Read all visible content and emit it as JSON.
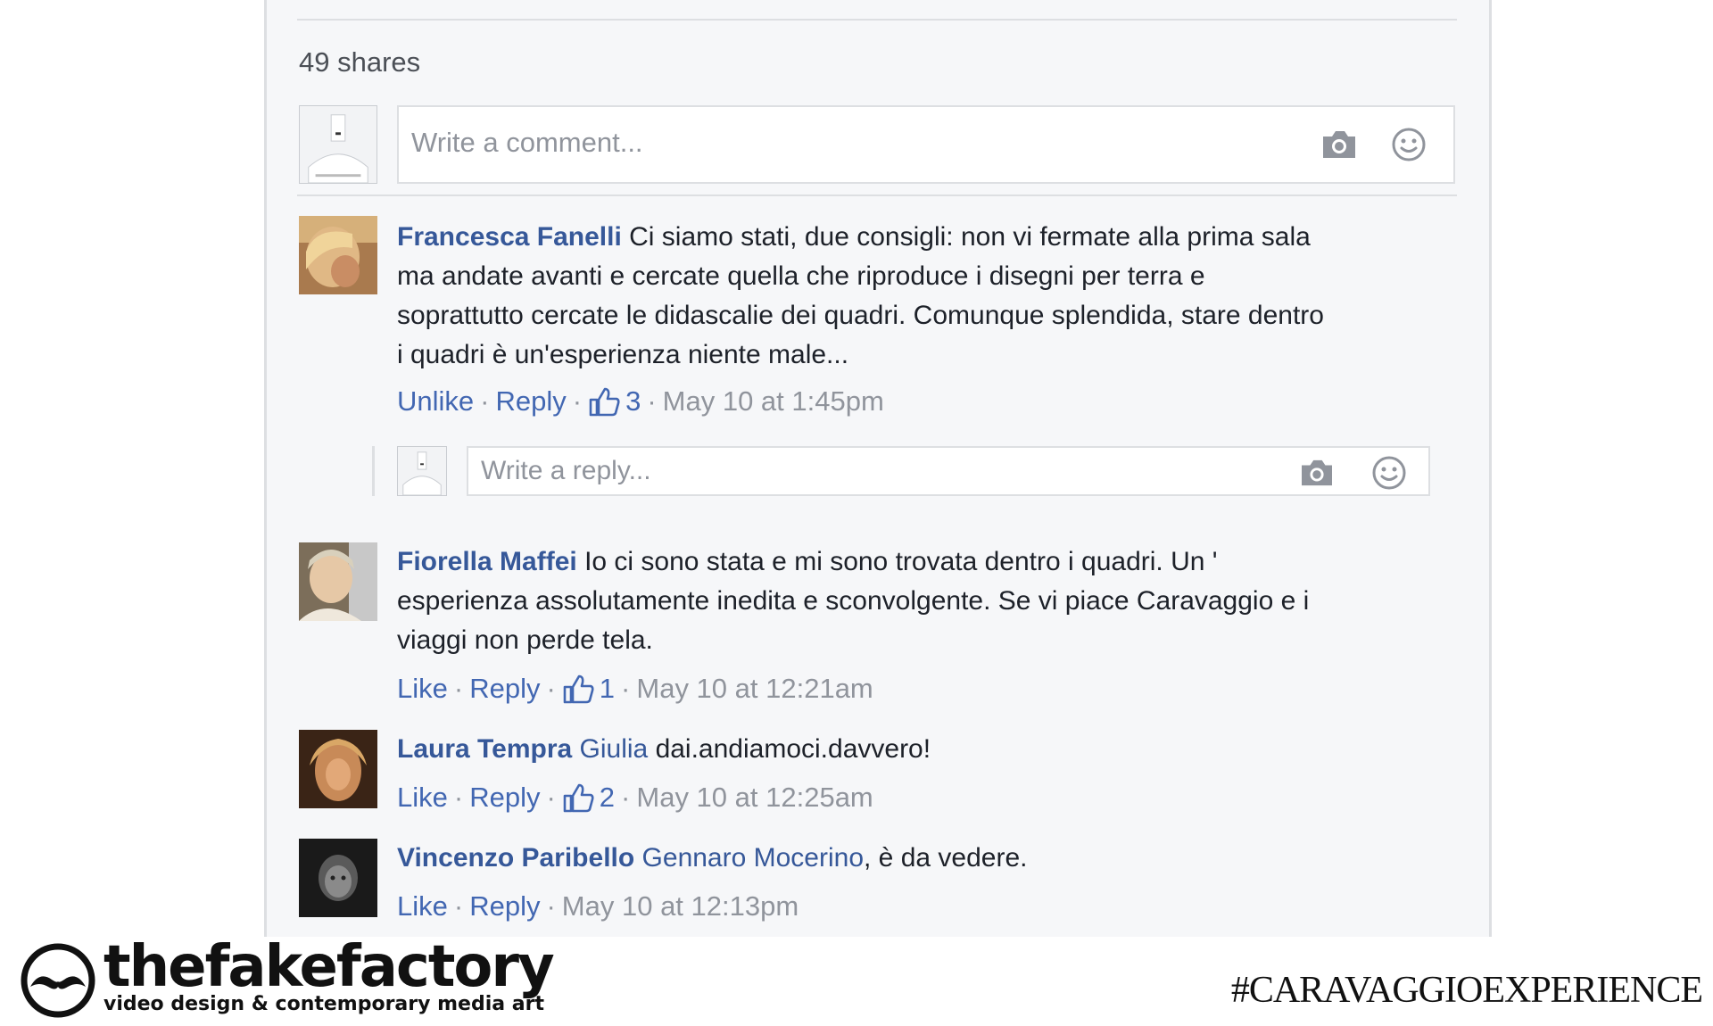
{
  "post": {
    "shares": "49 shares",
    "comment_placeholder": "Write a comment...",
    "reply_placeholder": "Write a reply..."
  },
  "icons": {
    "camera": "camera-icon",
    "emoji": "smiley-icon",
    "like": "thumbs-up-icon"
  },
  "comments": [
    {
      "author": "Francesca Fanelli",
      "lines": [
        "Ci siamo stati, due consigli: non vi fermate alla prima sala",
        "ma andate avanti e cercate quella che riproduce i disegni per terra e",
        "soprattutto cercate le didascalie dei quadri. Comunque splendida, stare dentro",
        "i quadri è un'esperienza niente male..."
      ],
      "like_action": "Unlike",
      "reply_action": "Reply",
      "likes": "3",
      "time": "May 10 at 1:45pm"
    },
    {
      "author": "Fiorella Maffei",
      "lines": [
        "Io ci sono stata e mi sono trovata dentro i quadri. Un '",
        "esperienza assolutamente inedita e sconvolgente. Se vi piace Caravaggio e i",
        "viaggi non perde tela."
      ],
      "like_action": "Like",
      "reply_action": "Reply",
      "likes": "1",
      "time": "May 10 at 12:21am"
    },
    {
      "author": "Laura Tempra",
      "mention": "Giulia",
      "text": "dai.andiamoci.davvero!",
      "like_action": "Like",
      "reply_action": "Reply",
      "likes": "2",
      "time": "May 10 at 12:25am"
    },
    {
      "author": "Vincenzo Paribello",
      "mention": "Gennaro Mocerino",
      "text": ", è da vedere.",
      "like_action": "Like",
      "reply_action": "Reply",
      "time": "May 10 at 12:13pm"
    }
  ],
  "branding": {
    "logo_name": "thefakefactory",
    "logo_tagline": "video design & contemporary media art",
    "hashtag": "#CARAVAGGIOEXPERIENCE"
  }
}
